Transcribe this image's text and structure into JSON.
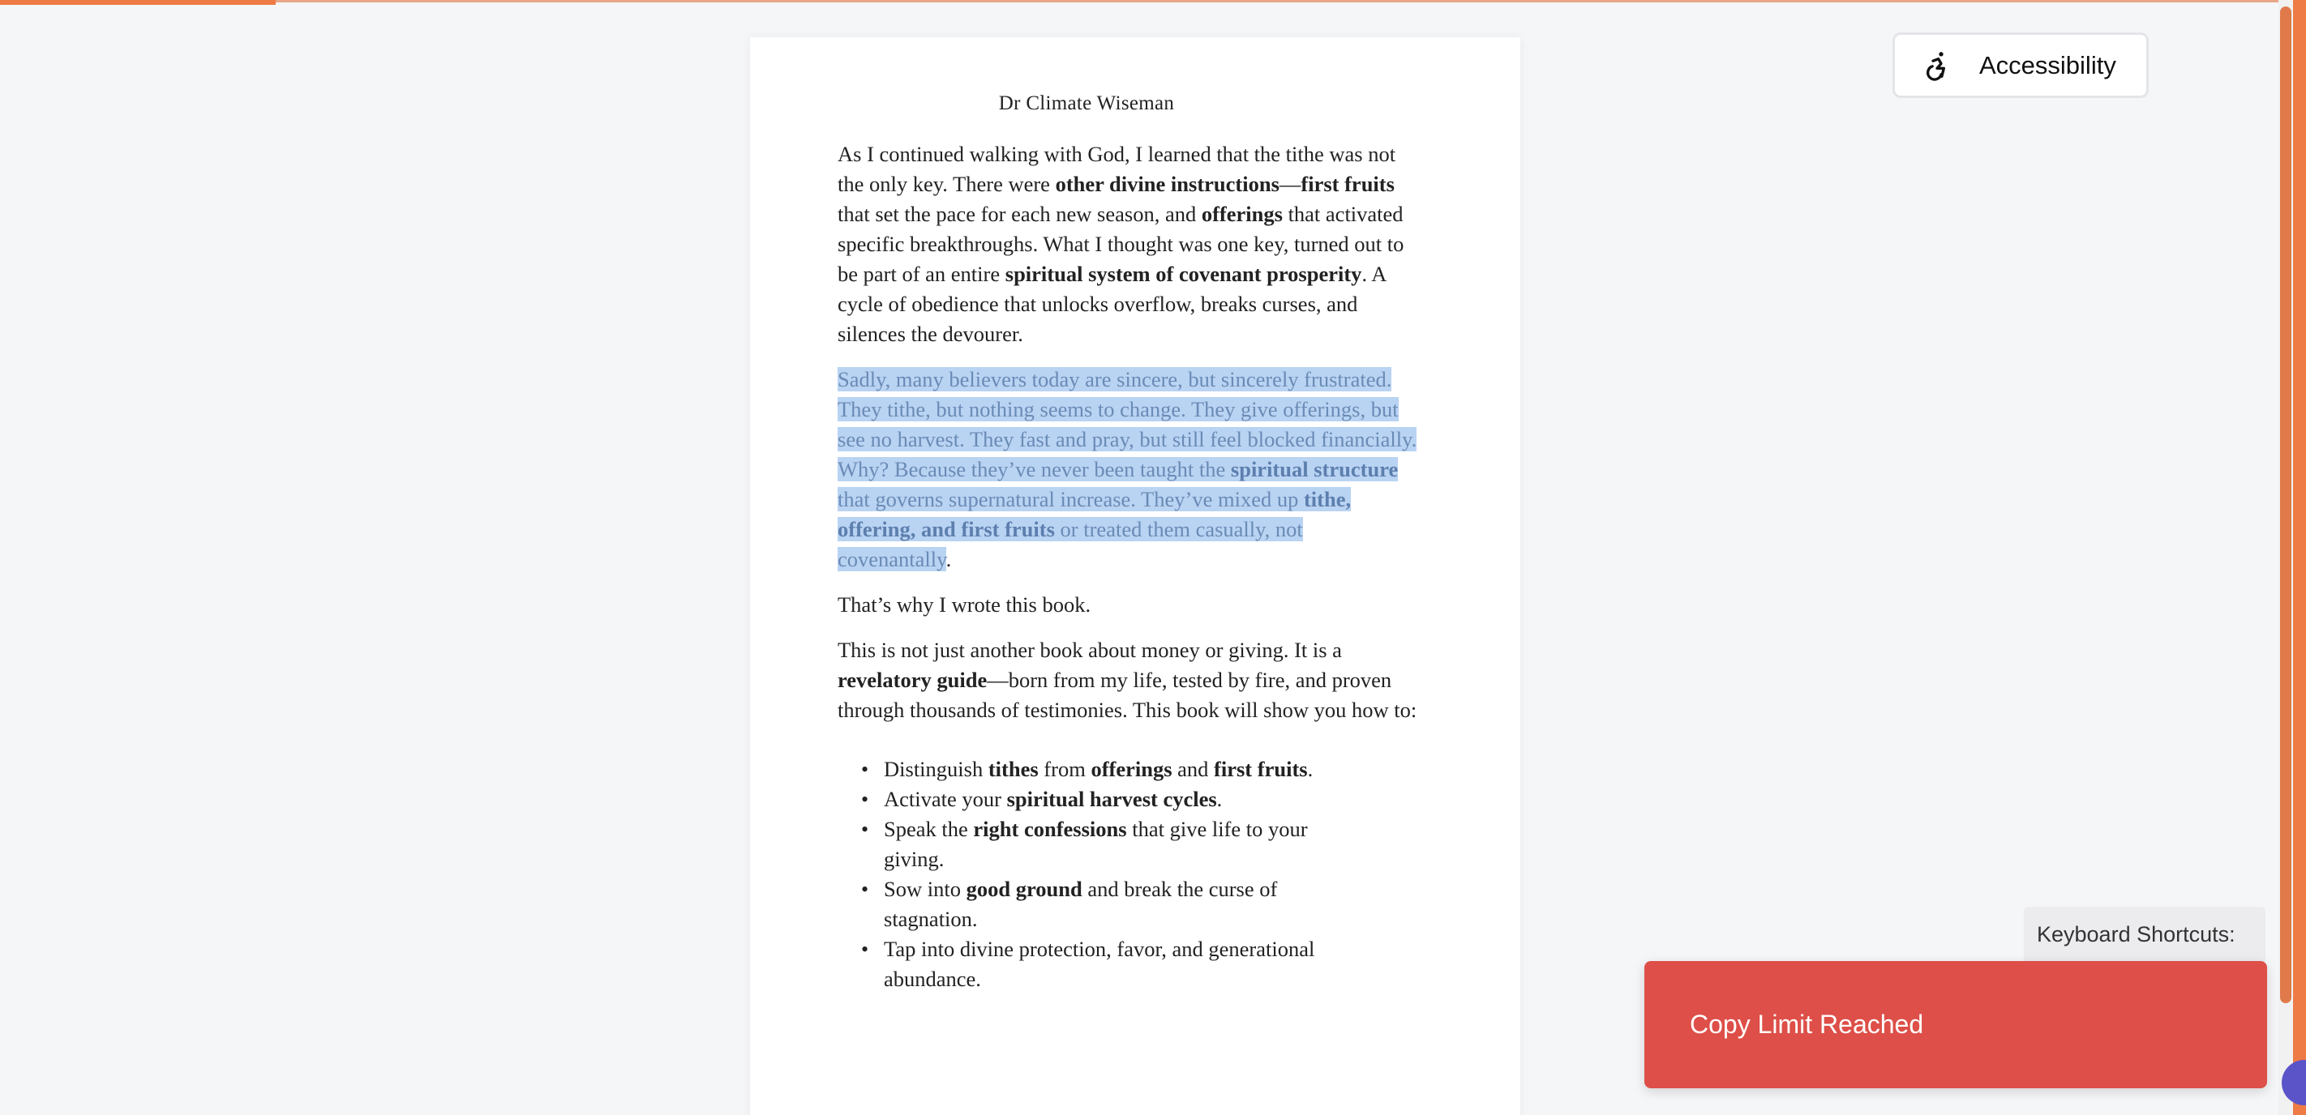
{
  "author": "Dr Climate Wiseman",
  "p1": {
    "t1": "As I continued walking with God, I learned that the tithe was not the only key. There were ",
    "b1": "other divine instructions",
    "t2": "—",
    "b2": "first fruits",
    "t3": " that set the pace for each new season, and ",
    "b3": "offerings",
    "t4": " that activated specific breakthroughs. What I thought was one key, turned out to be part of an entire ",
    "b4": "spiritual system of covenant prosperity",
    "t5": ". A cycle of obedience that unlocks overflow, breaks curses, and silences the devourer."
  },
  "p2": {
    "t1": "Sadly, many believers today are sincere, but sincerely frustrated. They tithe, but nothing seems to change. They give offerings, but see no harvest. They fast and pray, but still feel blocked financially. Why? Because they’ve never been taught the ",
    "b1": "spiritual structure",
    "t2": " that governs supernatural increase. They’ve mixed up ",
    "b2": "tithe, offering, and first fruits",
    "t3": " or treated them casually, not covenantally",
    "t4": "."
  },
  "p3": "That’s why I wrote this book.",
  "p4": {
    "t1": "This is not just another book about money or giving. It is a ",
    "b1": "revelatory guide",
    "t2": "—born from my life, tested by fire, and proven through thousands of testimonies. This book will show you how to:"
  },
  "list": {
    "i1": {
      "t1": "Distinguish ",
      "b1": "tithes",
      "t2": " from ",
      "b2": "offerings",
      "t3": " and ",
      "b3": "first fruits",
      "t4": "."
    },
    "i2": {
      "t1": "Activate your ",
      "b1": "spiritual harvest cycles",
      "t2": "."
    },
    "i3": {
      "t1": "Speak the ",
      "b1": "right confessions",
      "t2": " that give life to your giving."
    },
    "i4": {
      "t1": "Sow into ",
      "b1": "good ground",
      "t2": " and break the curse of stagnation."
    },
    "i5": {
      "t1": "Tap into divine protection, favor, and generational abundance."
    }
  },
  "accessibility": {
    "label": "Accessibility",
    "icon": "accessibility-icon"
  },
  "keyboard_shortcuts": "Keyboard Shortcuts:",
  "toast": "Copy Limit Reached",
  "colors": {
    "accent": "#ee7b46",
    "toast": "#dd4f48",
    "selection": "#b9d3f3"
  }
}
